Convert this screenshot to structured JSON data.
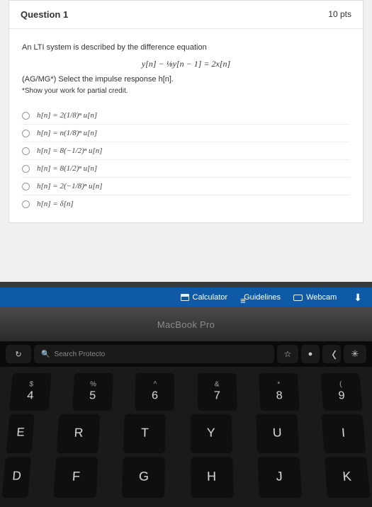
{
  "quiz": {
    "title": "Question 1",
    "points": "10 pts",
    "prompt_intro": "An LTI system is described by the difference equation",
    "equation": "y[n] − ⅛y[n − 1] = 2x[n]",
    "prompt_select": "(AG/MG*) Select the impulse response h[n].",
    "prompt_credit": "*Show your work for partial credit.",
    "options": [
      "h[n] = 2(1/8)ⁿ u[n]",
      "h[n] = n(1/8)ⁿ u[n]",
      "h[n] = 8(−1/2)ⁿ u[n]",
      "h[n] = 8(1/2)ⁿ u[n]",
      "h[n] = 2(−1/8)ⁿ u[n]",
      "h[n] = δ[n]"
    ]
  },
  "toolbar": {
    "calculator": "Calculator",
    "guidelines": "Guidelines",
    "webcam": "Webcam"
  },
  "bezel": {
    "label": "MacBook Pro"
  },
  "touchbar": {
    "refresh": "↻",
    "search_icon": "🔍",
    "search_text": "Search Protecto",
    "star": "☆",
    "dot": "●",
    "chev": "〈",
    "sun": "✳"
  },
  "keys": {
    "row1": [
      {
        "top": "$",
        "main": "4"
      },
      {
        "top": "%",
        "main": "5"
      },
      {
        "top": "^",
        "main": "6"
      },
      {
        "top": "&",
        "main": "7"
      },
      {
        "top": "*",
        "main": "8"
      },
      {
        "top": "(",
        "main": "9"
      }
    ],
    "row2_edge_left": "E",
    "row2": [
      "R",
      "T",
      "Y",
      "U",
      "I"
    ],
    "row3_edge_left": "D",
    "row3": [
      "F",
      "G",
      "H",
      "J",
      "K"
    ]
  }
}
